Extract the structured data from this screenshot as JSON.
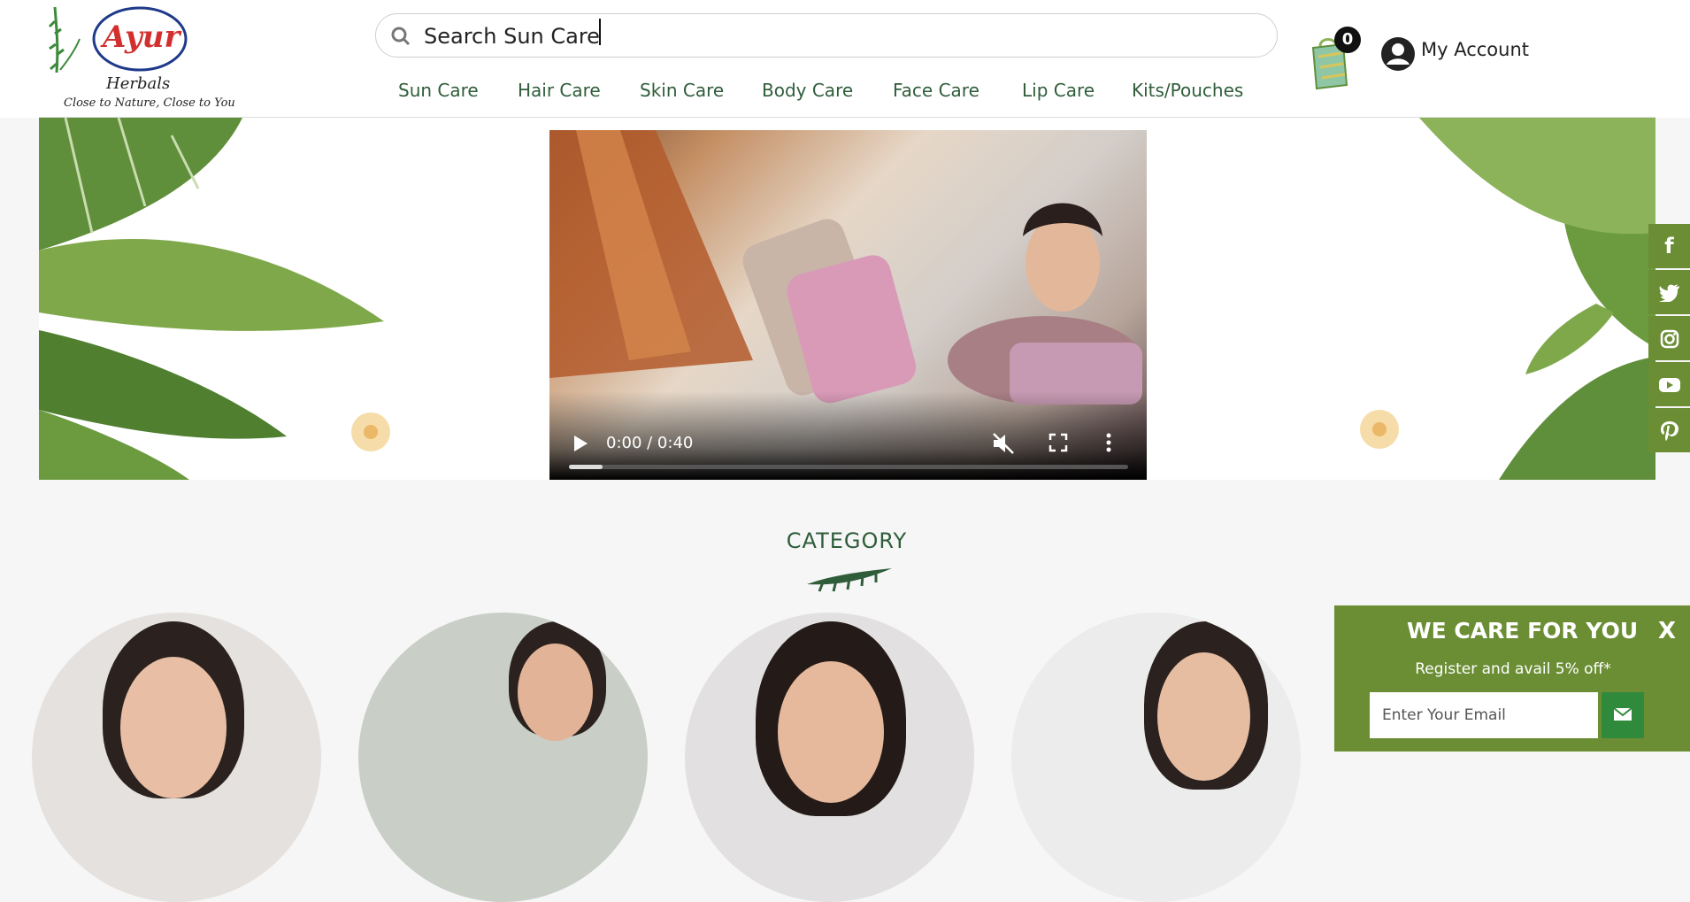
{
  "brand": {
    "name": "Ayur",
    "subtitle": "Herbals",
    "tagline": "Close to Nature, Close to You"
  },
  "search": {
    "placeholder": "Search Sun Care"
  },
  "nav": {
    "items": [
      "Sun Care",
      "Hair Care",
      "Skin Care",
      "Body Care",
      "Face Care",
      "Lip Care",
      "Kits/Pouches"
    ]
  },
  "cart": {
    "count": "0"
  },
  "account": {
    "label": "My Account"
  },
  "video": {
    "time": "0:00 / 0:40",
    "progress_fraction": 0.06
  },
  "social": {
    "items": [
      {
        "icon": "facebook-icon",
        "glyph": "f"
      },
      {
        "icon": "twitter-icon",
        "glyph": "🐦"
      },
      {
        "icon": "instagram-icon",
        "glyph": "◎"
      },
      {
        "icon": "youtube-icon",
        "glyph": "▶"
      },
      {
        "icon": "pinterest-icon",
        "glyph": "P"
      }
    ]
  },
  "category": {
    "title": "CATEGORY"
  },
  "popup": {
    "title": "WE CARE FOR YOU",
    "close": "X",
    "subtitle": "Register and avail 5% off*",
    "email_placeholder": "Enter Your Email"
  },
  "colors": {
    "brand_green": "#2f5d3a",
    "accent_olive": "#6b8e35",
    "send_green": "#2f8a3c",
    "logo_red": "#d32f2f"
  }
}
